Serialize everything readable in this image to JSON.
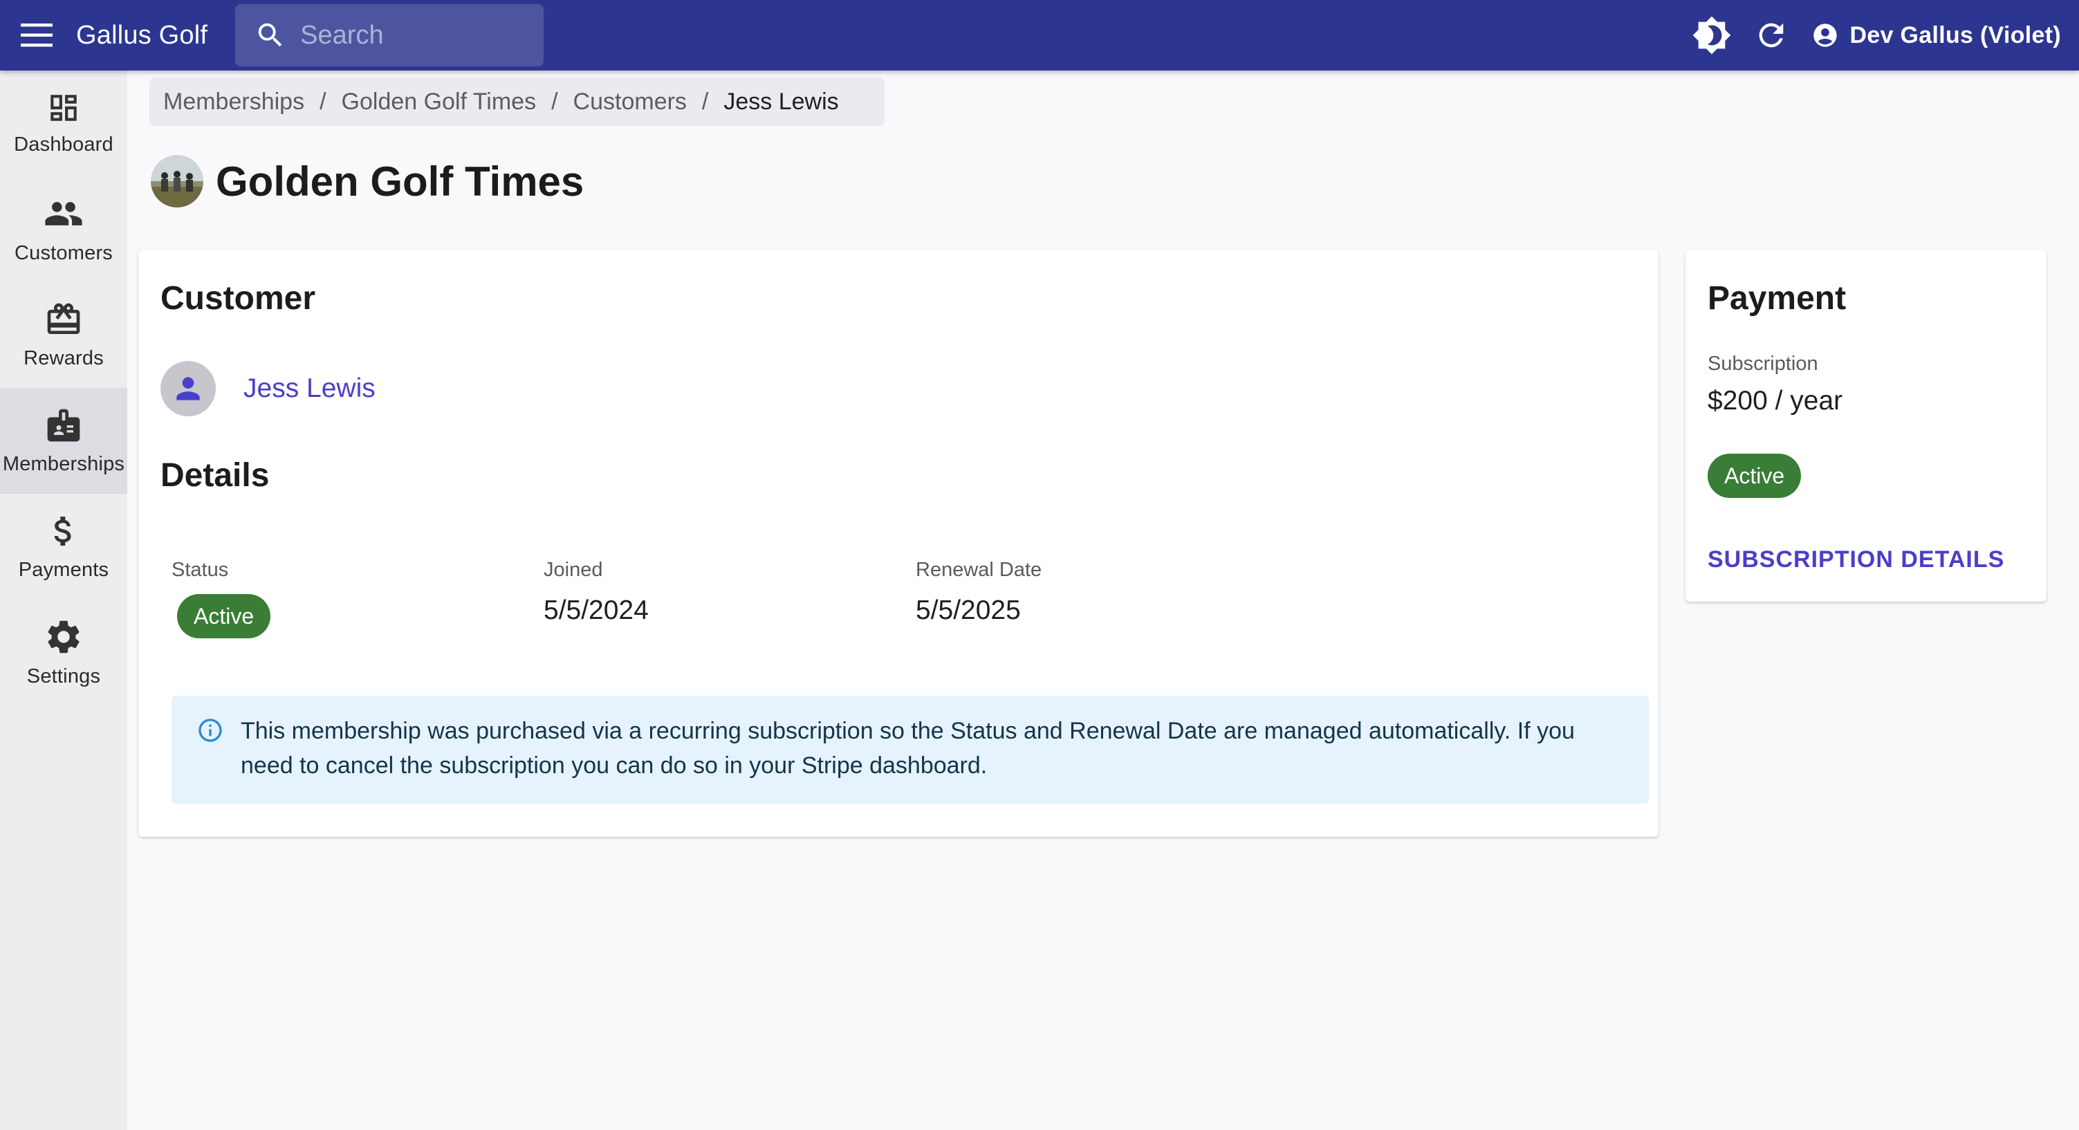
{
  "app": {
    "title": "Gallus Golf"
  },
  "search": {
    "placeholder": "Search"
  },
  "user": {
    "name": "Dev Gallus (Violet)"
  },
  "nav": {
    "items": [
      {
        "label": "Dashboard",
        "icon": "dashboard-icon"
      },
      {
        "label": "Customers",
        "icon": "customers-icon"
      },
      {
        "label": "Rewards",
        "icon": "rewards-icon"
      },
      {
        "label": "Memberships",
        "icon": "memberships-icon",
        "active": true
      },
      {
        "label": "Payments",
        "icon": "payments-icon"
      },
      {
        "label": "Settings",
        "icon": "settings-icon"
      }
    ]
  },
  "breadcrumb": {
    "items": [
      "Memberships",
      "Golden Golf Times",
      "Customers"
    ],
    "current": "Jess Lewis",
    "separator": "/"
  },
  "page": {
    "title": "Golden Golf Times"
  },
  "customer_card": {
    "title": "Customer",
    "customer_name": "Jess Lewis",
    "details_title": "Details",
    "status_label": "Status",
    "status_value": "Active",
    "joined_label": "Joined",
    "joined_value": "5/5/2024",
    "renewal_label": "Renewal Date",
    "renewal_value": "5/5/2025",
    "info_text": "This membership was purchased via a recurring subscription so the Status and Renewal Date are managed automatically. If you need to cancel the subscription you can do so in your Stripe dashboard."
  },
  "payment_card": {
    "title": "Payment",
    "subscription_label": "Subscription",
    "price": "$200 / year",
    "status": "Active",
    "details_link": "SUBSCRIPTION DETAILS"
  },
  "colors": {
    "topbar": "#2c3590",
    "accent": "#4a3fc9",
    "active_chip": "#3a7d36",
    "info_bg": "#e6f3fc"
  }
}
